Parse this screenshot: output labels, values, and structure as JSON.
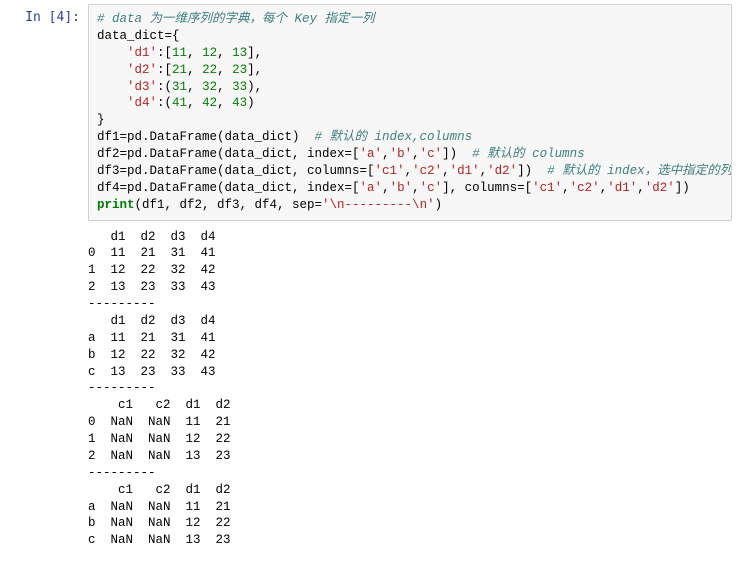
{
  "prompt": "In [4]:",
  "code": {
    "l1_comment": "# data 为一维序列的字典，每个 Key 指定一列",
    "l2_a": "data_dict={",
    "l3_a": "    ",
    "l3_k": "'d1'",
    "l3_b": ":[",
    "l3_v1": "11",
    "l3_c": ", ",
    "l3_v2": "12",
    "l3_d": ", ",
    "l3_v3": "13",
    "l3_e": "],",
    "l4_a": "    ",
    "l4_k": "'d2'",
    "l4_b": ":[",
    "l4_v1": "21",
    "l4_c": ", ",
    "l4_v2": "22",
    "l4_d": ", ",
    "l4_v3": "23",
    "l4_e": "],",
    "l5_a": "    ",
    "l5_k": "'d3'",
    "l5_b": ":(",
    "l5_v1": "31",
    "l5_c": ", ",
    "l5_v2": "32",
    "l5_d": ", ",
    "l5_v3": "33",
    "l5_e": "),",
    "l6_a": "    ",
    "l6_k": "'d4'",
    "l6_b": ":(",
    "l6_v1": "41",
    "l6_c": ", ",
    "l6_v2": "42",
    "l6_d": ", ",
    "l6_v3": "43",
    "l6_e": ")",
    "l7_a": "}",
    "l8_a": "df1=pd.DataFrame(data_dict)  ",
    "l8_c": "# 默认的 index,columns",
    "l9_a": "df2=pd.DataFrame(data_dict, index=[",
    "l9_s1": "'a'",
    "l9_b": ",",
    "l9_s2": "'b'",
    "l9_c": ",",
    "l9_s3": "'c'",
    "l9_d": "])  ",
    "l9_cm": "# 默认的 columns",
    "l10_a": "df3=pd.DataFrame(data_dict, columns=[",
    "l10_s1": "'c1'",
    "l10_b": ",",
    "l10_s2": "'c2'",
    "l10_c": ",",
    "l10_s3": "'d1'",
    "l10_d": ",",
    "l10_s4": "'d2'",
    "l10_e": "])  ",
    "l10_cm": "# 默认的 index，选中指定的列",
    "l11_a": "df4=pd.DataFrame(data_dict, index=[",
    "l11_s1": "'a'",
    "l11_b": ",",
    "l11_s2": "'b'",
    "l11_c": ",",
    "l11_s3": "'c'",
    "l11_d": "], columns=[",
    "l11_s5": "'c1'",
    "l11_e": ",",
    "l11_s6": "'c2'",
    "l11_f": ",",
    "l11_s7": "'d1'",
    "l11_g": ",",
    "l11_s8": "'d2'",
    "l11_h": "])",
    "l12_a": "print",
    "l12_b": "(df1, df2, df3, df4, sep=",
    "l12_s": "'\\n---------\\n'",
    "l12_c": ")"
  },
  "output": "   d1  d2  d3  d4\n0  11  21  31  41\n1  12  22  32  42\n2  13  23  33  43\n---------\n   d1  d2  d3  d4\na  11  21  31  41\nb  12  22  32  42\nc  13  23  33  43\n---------\n    c1   c2  d1  d2\n0  NaN  NaN  11  21\n1  NaN  NaN  12  22\n2  NaN  NaN  13  23\n---------\n    c1   c2  d1  d2\na  NaN  NaN  11  21\nb  NaN  NaN  12  22\nc  NaN  NaN  13  23",
  "chart_data": {
    "type": "table",
    "input_dict": {
      "d1": [
        11,
        12,
        13
      ],
      "d2": [
        21,
        22,
        23
      ],
      "d3": [
        31,
        32,
        33
      ],
      "d4": [
        41,
        42,
        43
      ]
    },
    "tables": [
      {
        "name": "df1",
        "index": [
          0,
          1,
          2
        ],
        "columns": [
          "d1",
          "d2",
          "d3",
          "d4"
        ],
        "rows": [
          [
            11,
            21,
            31,
            41
          ],
          [
            12,
            22,
            32,
            42
          ],
          [
            13,
            23,
            33,
            43
          ]
        ]
      },
      {
        "name": "df2",
        "index": [
          "a",
          "b",
          "c"
        ],
        "columns": [
          "d1",
          "d2",
          "d3",
          "d4"
        ],
        "rows": [
          [
            11,
            21,
            31,
            41
          ],
          [
            12,
            22,
            32,
            42
          ],
          [
            13,
            23,
            33,
            43
          ]
        ]
      },
      {
        "name": "df3",
        "index": [
          0,
          1,
          2
        ],
        "columns": [
          "c1",
          "c2",
          "d1",
          "d2"
        ],
        "rows": [
          [
            "NaN",
            "NaN",
            11,
            21
          ],
          [
            "NaN",
            "NaN",
            12,
            22
          ],
          [
            "NaN",
            "NaN",
            13,
            23
          ]
        ]
      },
      {
        "name": "df4",
        "index": [
          "a",
          "b",
          "c"
        ],
        "columns": [
          "c1",
          "c2",
          "d1",
          "d2"
        ],
        "rows": [
          [
            "NaN",
            "NaN",
            11,
            21
          ],
          [
            "NaN",
            "NaN",
            12,
            22
          ],
          [
            "NaN",
            "NaN",
            13,
            23
          ]
        ]
      }
    ]
  }
}
